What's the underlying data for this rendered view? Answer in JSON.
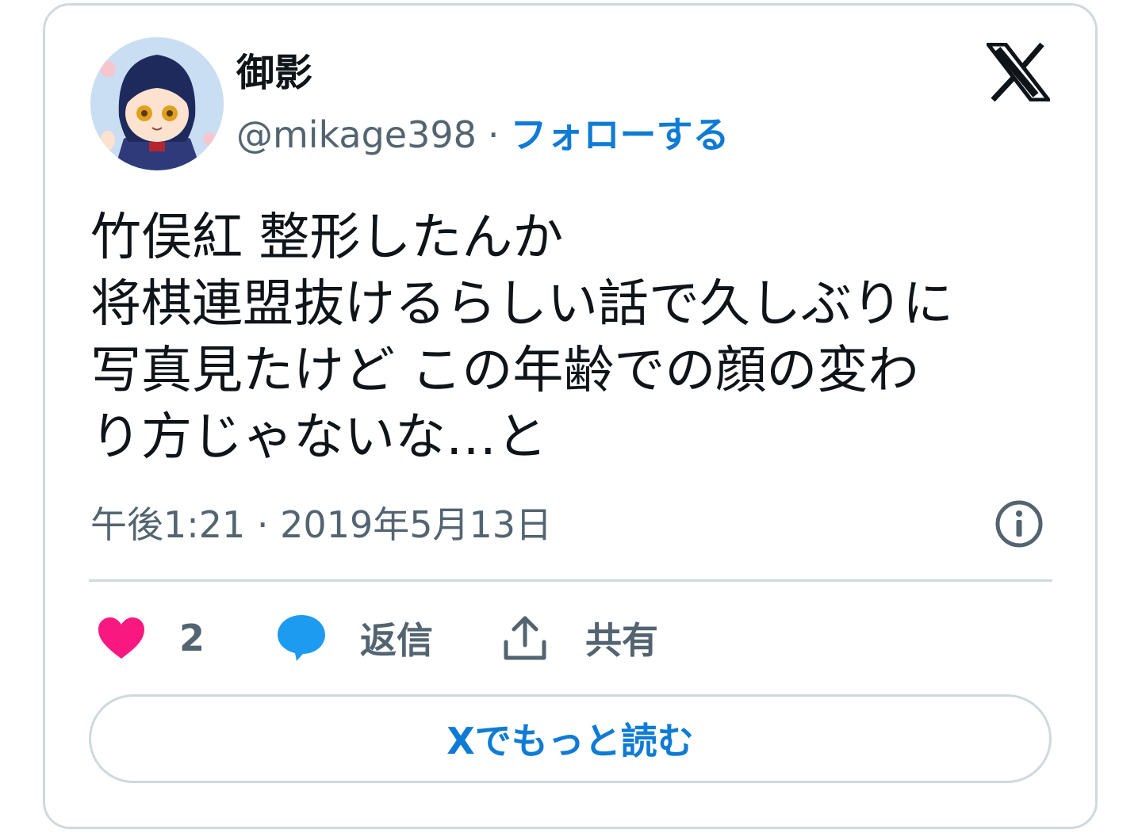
{
  "author": {
    "display_name": "御影",
    "handle": "@mikage398",
    "separator": "·",
    "follow_label": "フォローする"
  },
  "tweet": {
    "lines": [
      "竹俣紅 整形したんか",
      "将棋連盟抜けるらしい話で久しぶりに",
      "写真見たけど この年齢での顔の変わ",
      "り方じゃないな…と"
    ],
    "timestamp": "午後1:21 · 2019年5月13日"
  },
  "actions": {
    "like_count": "2",
    "reply_label": "返信",
    "share_label": "共有"
  },
  "read_more_label": "Xでもっと読む",
  "icons": {
    "brand": "x-logo-icon",
    "info": "info-icon",
    "like": "heart-icon",
    "reply": "speech-bubble-icon",
    "share": "upload-share-icon"
  },
  "colors": {
    "text": "#0f1419",
    "secondary": "#536471",
    "link": "#0f7bd5",
    "heart": "#f91880",
    "reply_bubble": "#1d9bf0",
    "border": "#cfd9de"
  }
}
